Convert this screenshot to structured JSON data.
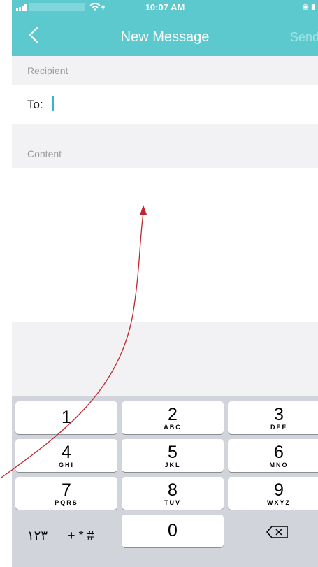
{
  "status_bar": {
    "time": "10:07 AM",
    "wifi_icon": "wifi-icon",
    "right_icons": "◉ ▮"
  },
  "nav": {
    "title": "New Message",
    "send_label": "Send",
    "back_icon": "chevron-left-icon"
  },
  "recipient": {
    "section_label": "Recipient",
    "to_label": "To:"
  },
  "content": {
    "section_label": "Content"
  },
  "keypad": {
    "keys": [
      {
        "digit": "1",
        "letters": ""
      },
      {
        "digit": "2",
        "letters": "ABC"
      },
      {
        "digit": "3",
        "letters": "DEF"
      },
      {
        "digit": "4",
        "letters": "GHI"
      },
      {
        "digit": "5",
        "letters": "JKL"
      },
      {
        "digit": "6",
        "letters": "MNO"
      },
      {
        "digit": "7",
        "letters": "PQRS"
      },
      {
        "digit": "8",
        "letters": "TUV"
      },
      {
        "digit": "9",
        "letters": "WXYZ"
      },
      {
        "digit": "0",
        "letters": ""
      }
    ],
    "arabic_numerals_label": "١٢٣",
    "symbols_label": "+ * #",
    "delete_icon": "backspace-icon"
  },
  "colors": {
    "accent": "#5bc9ce",
    "annotation_arrow": "#c0272d"
  }
}
